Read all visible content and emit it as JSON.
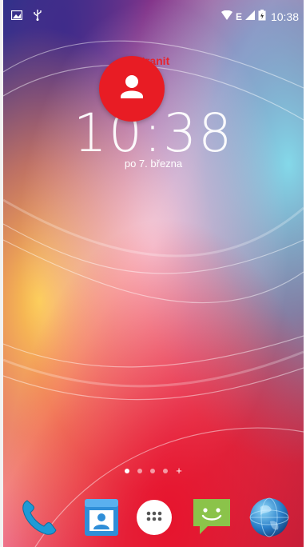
{
  "status_bar": {
    "network": "E",
    "time": "10:38",
    "icons": [
      "image-notification-icon",
      "usb-icon",
      "wifi-icon",
      "signal-icon",
      "battery-icon"
    ]
  },
  "drag_target": {
    "remove_label": "Odstranit"
  },
  "lock_clock": {
    "time": "10:38",
    "date": "po 7. března"
  },
  "home_pages": {
    "page_count": 4,
    "active_page": 1,
    "add_label": "+"
  },
  "dock": {
    "apps": [
      "phone-icon",
      "contacts-icon",
      "all-apps-icon",
      "messaging-icon",
      "browser-icon"
    ]
  },
  "colors": {
    "remove_red": "#e81c24",
    "status_text": "#ffffff"
  }
}
